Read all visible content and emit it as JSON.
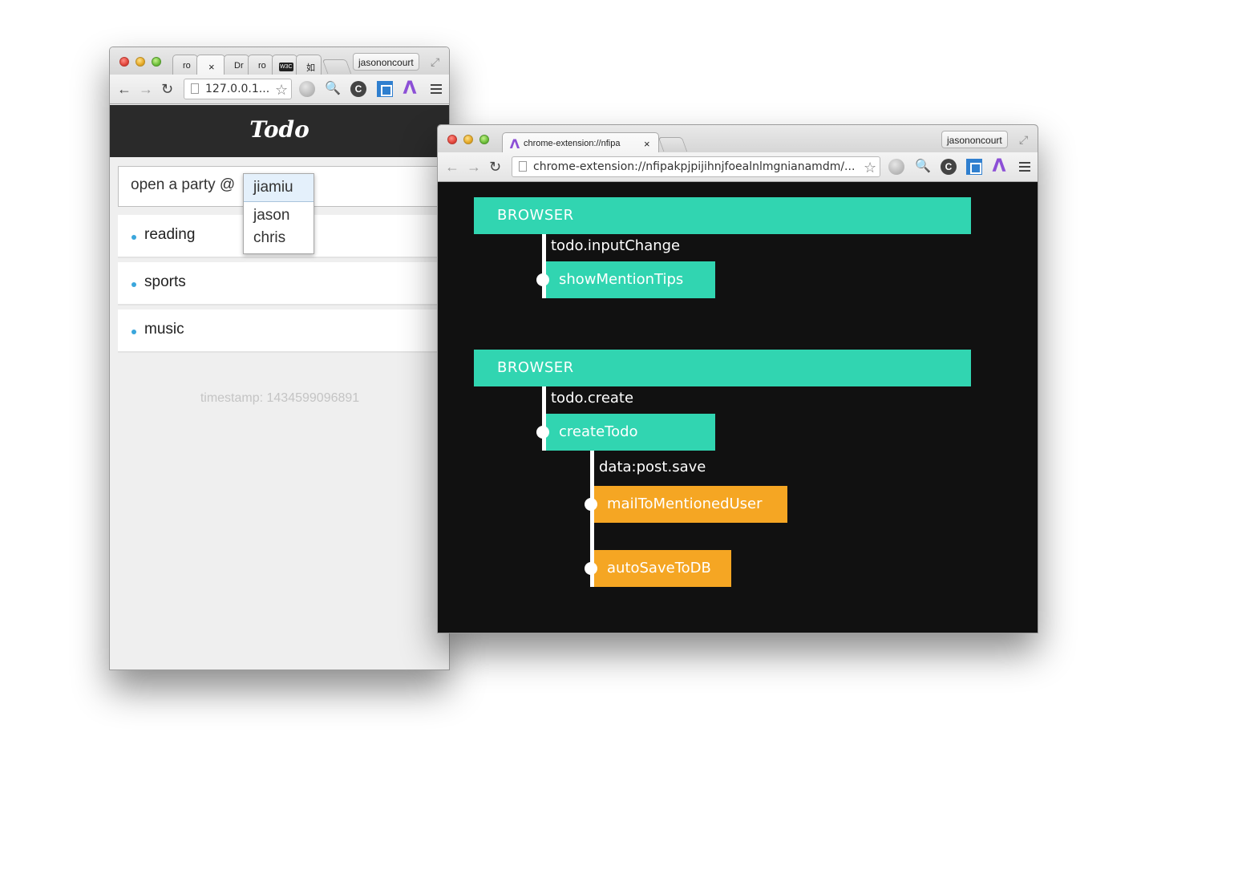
{
  "todo_window": {
    "tabs": [
      "ro",
      "",
      "Dr",
      "ro",
      "W3C",
      "如"
    ],
    "active_tab_close": "×",
    "profile": "jasononcourt",
    "url": "127.0.0.1...",
    "app_title": "Todo",
    "input_value": "open a party @",
    "mention_options": [
      "jiamiu",
      "jason",
      "chris"
    ],
    "items": [
      "reading",
      "sports",
      "music"
    ],
    "timestamp": "timestamp: 1434599096891"
  },
  "flow_window": {
    "tab_title": "chrome-extension://nfipa",
    "tab_close": "×",
    "profile": "jasononcourt",
    "url": "chrome-extension://nfipakpjpijihnjfoealnlmgnianamdm/...",
    "groups": [
      {
        "source": "BROWSER",
        "event": "todo.inputChange",
        "handler": "showMentionTips"
      },
      {
        "source": "BROWSER",
        "event": "todo.create",
        "handler": "createTodo",
        "child_event": "data:post.save",
        "child_handlers": [
          "mailToMentionedUser",
          "autoSaveToDB"
        ]
      }
    ]
  },
  "colors": {
    "teal": "#31d5b1",
    "orange": "#f5a623",
    "flow_background": "#111111",
    "todo_header": "#2a2a2a",
    "bullet": "#3aa6dc"
  },
  "icons": [
    "back-arrow-icon",
    "forward-arrow-icon",
    "reload-icon",
    "page-icon",
    "star-icon",
    "globe-icon",
    "magnifier-icon",
    "c-circle-icon",
    "qr-code-icon",
    "lambda-icon",
    "menu-icon",
    "fullscreen-icon"
  ]
}
